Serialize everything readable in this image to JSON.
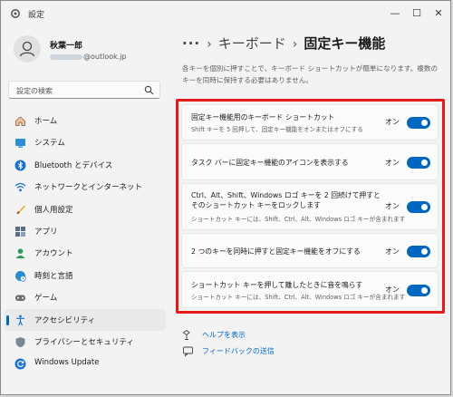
{
  "window": {
    "title": "設定",
    "minimize": "—",
    "maximize": "☐",
    "close": "✕"
  },
  "profile": {
    "name": "秋葉一郎",
    "email_domain": "@outlook.jp"
  },
  "search": {
    "placeholder": "設定の検索",
    "icon": "search-icon"
  },
  "sidebar": {
    "items": [
      {
        "label": "ホーム",
        "icon": "home-icon"
      },
      {
        "label": "システム",
        "icon": "system-icon"
      },
      {
        "label": "Bluetooth とデバイス",
        "icon": "bluetooth-icon"
      },
      {
        "label": "ネットワークとインターネット",
        "icon": "network-icon"
      },
      {
        "label": "個人用設定",
        "icon": "brush-icon"
      },
      {
        "label": "アプリ",
        "icon": "apps-icon"
      },
      {
        "label": "アカウント",
        "icon": "account-icon"
      },
      {
        "label": "時刻と言語",
        "icon": "globe-clock-icon"
      },
      {
        "label": "ゲーム",
        "icon": "gamepad-icon"
      },
      {
        "label": "アクセシビリティ",
        "icon": "accessibility-icon",
        "active": true
      },
      {
        "label": "プライバシーとセキュリティ",
        "icon": "shield-icon"
      },
      {
        "label": "Windows Update",
        "icon": "update-icon"
      }
    ]
  },
  "breadcrumb": {
    "more": "···",
    "sep": "›",
    "parent": "キーボード",
    "current": "固定キー機能"
  },
  "description": "各キーを個別に押すことで、キーボード ショートカットが簡単になります。複数のキーを同時に保持する必要はありません。",
  "settings": [
    {
      "title": "固定キー機能用のキーボード ショートカット",
      "subtitle": "Shift キーを 5 回押して、固定キー機能をオンまたはオフにする",
      "state": "オン",
      "on": true
    },
    {
      "title": "タスク バーに固定キー機能のアイコンを表示する",
      "subtitle": "",
      "state": "オン",
      "on": true
    },
    {
      "title": "Ctrl、Alt、Shift、Windows ロゴ キーを 2 回続けて押すとそのショートカット キーをロックします",
      "subtitle": "ショートカット キーには、Shift、Ctrl、Alt、Windows ロゴ キーが含まれます",
      "state": "オン",
      "on": true
    },
    {
      "title": "2 つのキーを同時に押すと固定キー機能をオフにする",
      "subtitle": "",
      "state": "オン",
      "on": true
    },
    {
      "title": "ショートカット キーを押して離したときに音を鳴らす",
      "subtitle": "ショートカット キーには、Shift、Ctrl、Alt、Windows ロゴ キーが含まれます",
      "state": "オン",
      "on": true
    }
  ],
  "links": {
    "help": "ヘルプを表示",
    "feedback": "フィードバックの送信"
  },
  "colors": {
    "accent": "#0067c0",
    "highlight": "#e21b1b",
    "background": "#f3f3f3",
    "card": "#fbfbfb"
  }
}
